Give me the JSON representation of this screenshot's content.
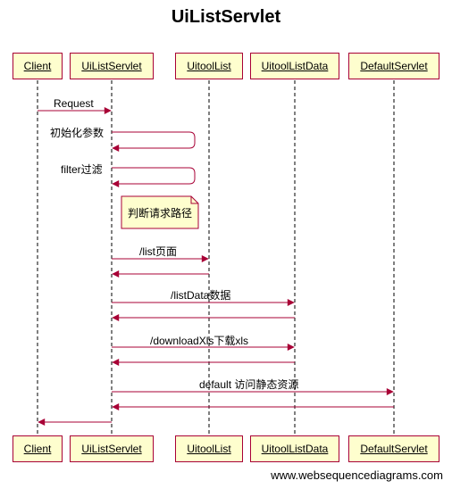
{
  "title": "UiListServlet",
  "participants": [
    "Client",
    "UiListServlet",
    "UitoolList",
    "UitoolListData",
    "DefaultServlet"
  ],
  "messages": [
    "Request",
    "初始化参数",
    "filter过滤",
    "/list页面",
    "/listData数据",
    "/downloadXls下载xls",
    "default 访问静态资源"
  ],
  "note": "判断请求路径",
  "footer": "www.websequencediagrams.com",
  "colors": {
    "line": "#a80036",
    "box_fill": "#fefece",
    "note_fill": "#fefece"
  }
}
